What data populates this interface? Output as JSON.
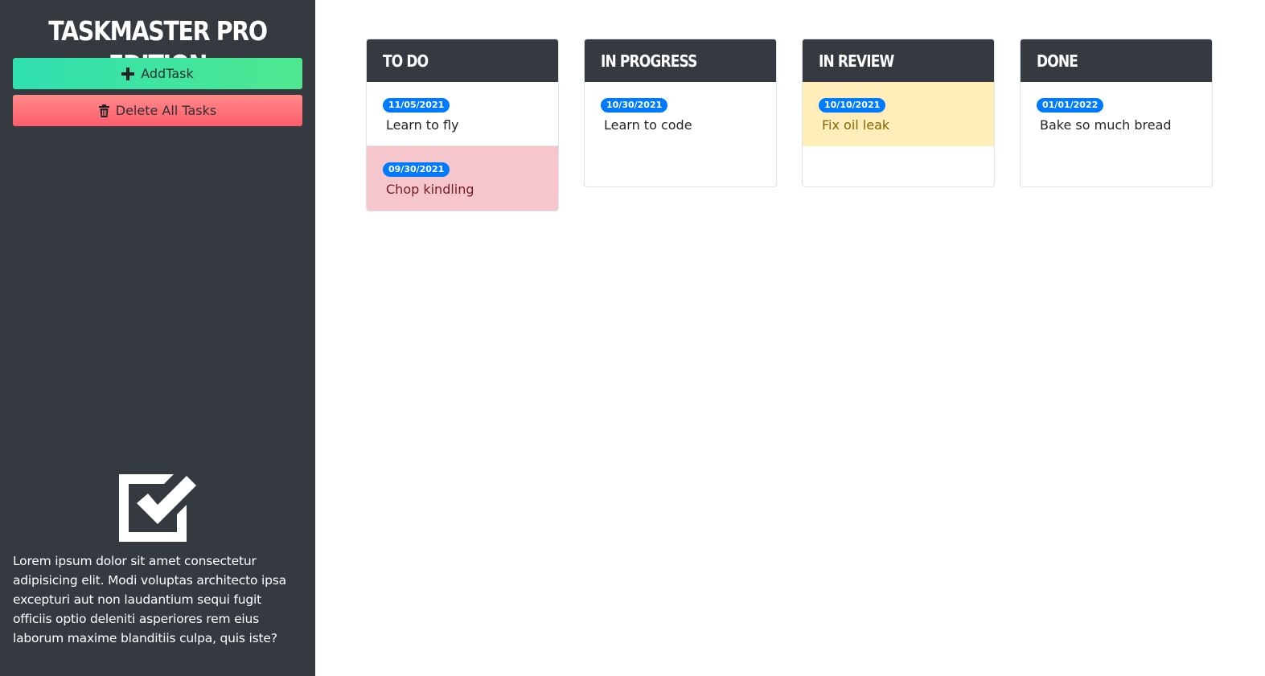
{
  "app": {
    "title": "TASKMASTER PRO EDITION"
  },
  "sidebar": {
    "add_button": {
      "label": "AddTask",
      "icon": "plus-icon"
    },
    "delete_button": {
      "label": "Delete All Tasks",
      "icon": "trash-icon"
    },
    "logo_icon": "checkbox-checked-icon",
    "description": "Lorem ipsum dolor sit amet consectetur adipisicing elit. Modi voluptas architecto ipsa excepturi aut non laudantium sequi fugit officiis optio deleniti asperiores rem eius laborum maxime blanditiis culpa, quis iste?"
  },
  "columns": [
    {
      "title": "TO DO",
      "tasks": [
        {
          "date": "11/05/2021",
          "text": "Learn to fly",
          "status": "default"
        },
        {
          "date": "09/30/2021",
          "text": "Chop kindling",
          "status": "danger"
        }
      ]
    },
    {
      "title": "IN PROGRESS",
      "tasks": [
        {
          "date": "10/30/2021",
          "text": "Learn to code",
          "status": "default"
        }
      ]
    },
    {
      "title": "IN REVIEW",
      "tasks": [
        {
          "date": "10/10/2021",
          "text": "Fix oil leak",
          "status": "warning"
        }
      ]
    },
    {
      "title": "DONE",
      "tasks": [
        {
          "date": "01/01/2022",
          "text": "Bake so much bread",
          "status": "default"
        }
      ]
    }
  ],
  "colors": {
    "sidebar_bg": "#343a40",
    "add_button": "#3ee6a0",
    "delete_button": "#ff6b73",
    "badge": "#007bff",
    "danger_card": "#f5c6cb",
    "warning_card": "#ffeeba"
  }
}
